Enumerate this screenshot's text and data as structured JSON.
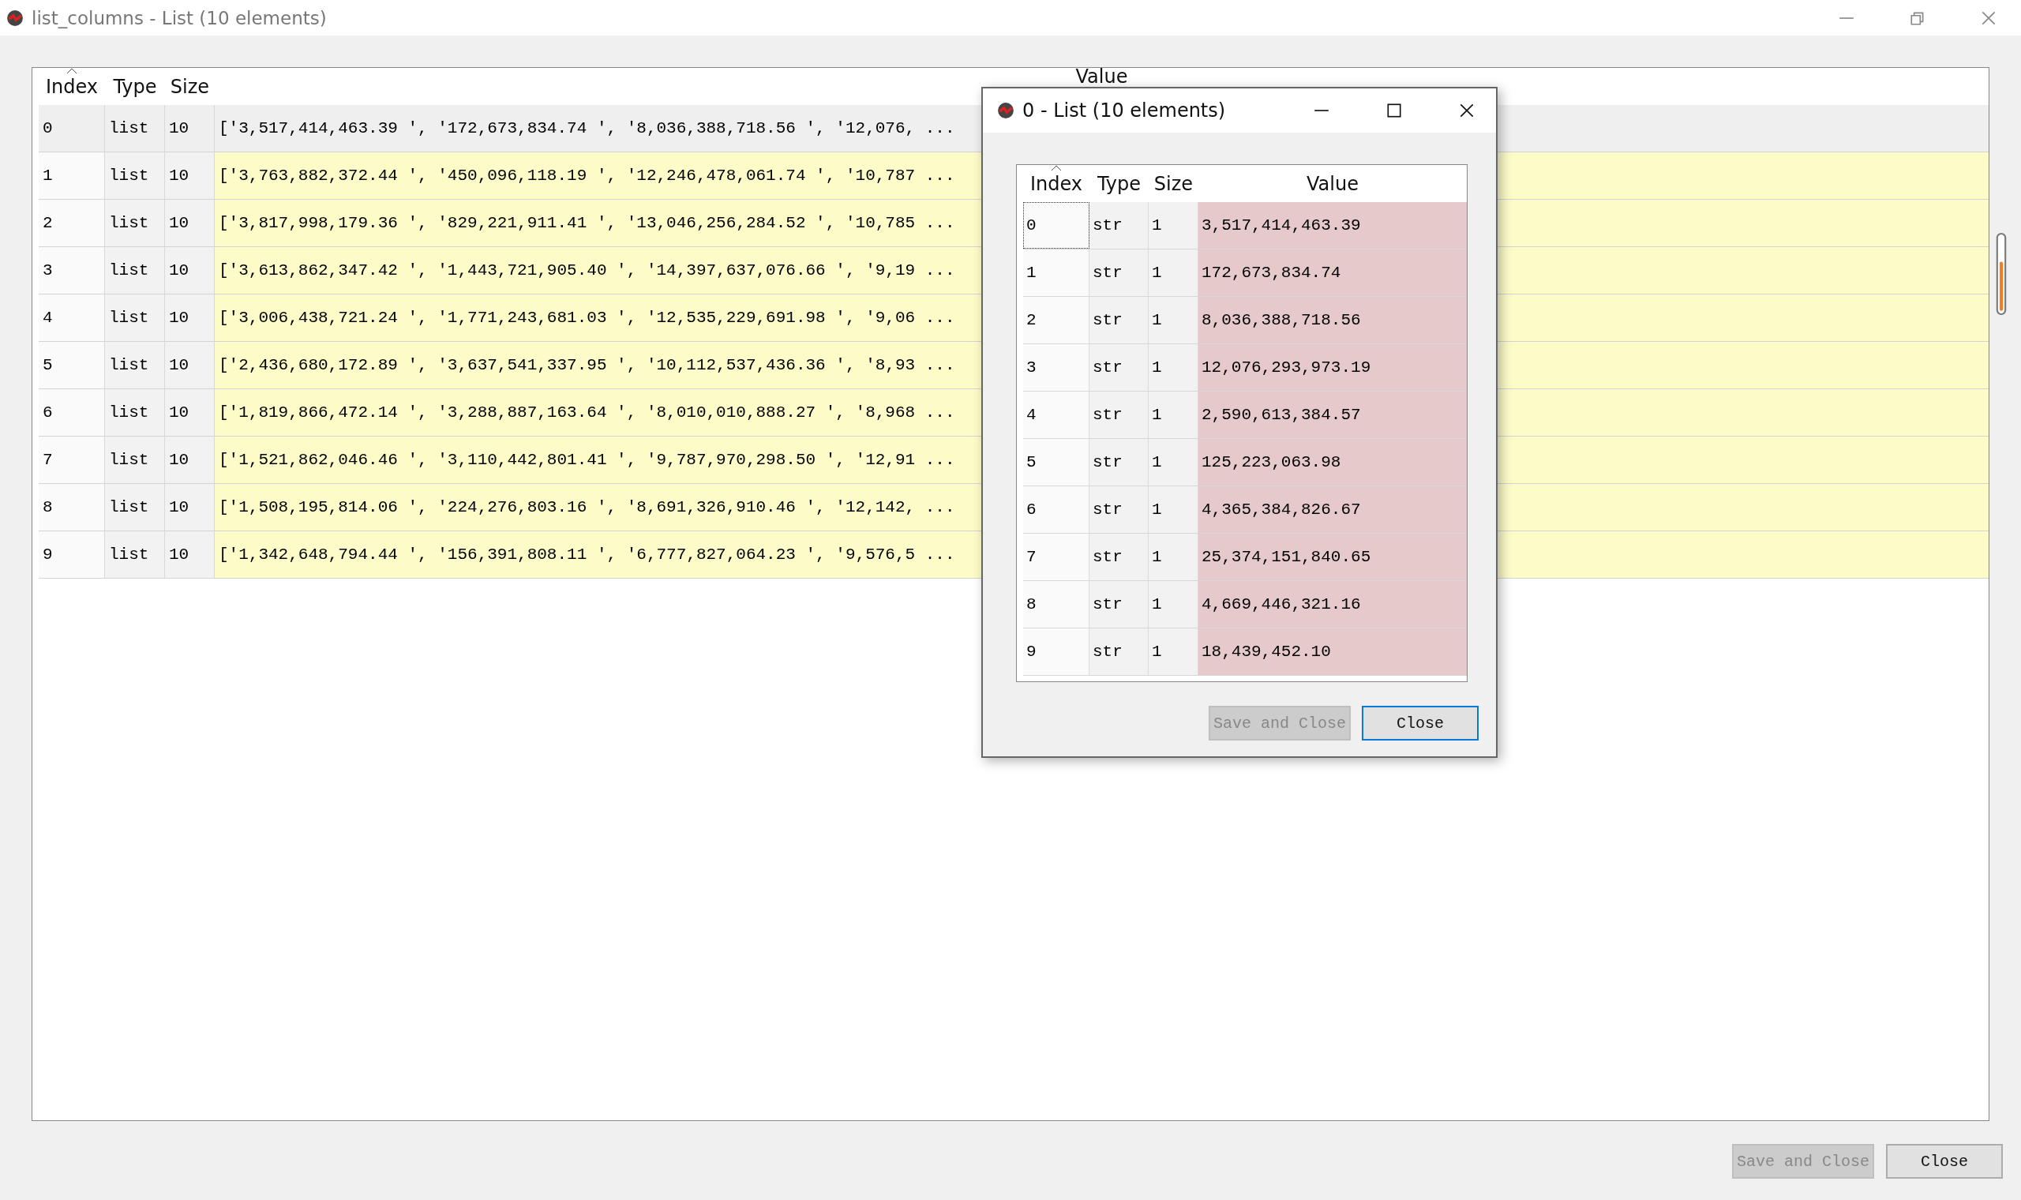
{
  "window": {
    "title": "list_columns - List (10 elements)"
  },
  "table": {
    "columns": [
      {
        "label": "Index",
        "sorted": true
      },
      {
        "label": "Type",
        "sorted": false
      },
      {
        "label": "Size",
        "sorted": false
      },
      {
        "label": "Value",
        "sorted": false
      }
    ],
    "rows": [
      {
        "index": "0",
        "type": "list",
        "size": "10",
        "value": "['3,517,414,463.39 ', '172,673,834.74 ', '8,036,388,718.56 ', '12,076, ...",
        "selected": true
      },
      {
        "index": "1",
        "type": "list",
        "size": "10",
        "value": "['3,763,882,372.44 ', '450,096,118.19 ', '12,246,478,061.74 ', '10,787 ...",
        "selected": false
      },
      {
        "index": "2",
        "type": "list",
        "size": "10",
        "value": "['3,817,998,179.36 ', '829,221,911.41 ', '13,046,256,284.52 ', '10,785 ...",
        "selected": false
      },
      {
        "index": "3",
        "type": "list",
        "size": "10",
        "value": "['3,613,862,347.42 ', '1,443,721,905.40 ', '14,397,637,076.66 ', '9,19 ...",
        "selected": false
      },
      {
        "index": "4",
        "type": "list",
        "size": "10",
        "value": "['3,006,438,721.24 ', '1,771,243,681.03 ', '12,535,229,691.98 ', '9,06 ...",
        "selected": false
      },
      {
        "index": "5",
        "type": "list",
        "size": "10",
        "value": "['2,436,680,172.89 ', '3,637,541,337.95 ', '10,112,537,436.36 ', '8,93 ...",
        "selected": false
      },
      {
        "index": "6",
        "type": "list",
        "size": "10",
        "value": "['1,819,866,472.14 ', '3,288,887,163.64 ', '8,010,010,888.27 ', '8,968 ...",
        "selected": false
      },
      {
        "index": "7",
        "type": "list",
        "size": "10",
        "value": "['1,521,862,046.46 ', '3,110,442,801.41 ', '9,787,970,298.50 ', '12,91 ...",
        "selected": false
      },
      {
        "index": "8",
        "type": "list",
        "size": "10",
        "value": "['1,508,195,814.06 ', '224,276,803.16 ', '8,691,326,910.46 ', '12,142, ...",
        "selected": false
      },
      {
        "index": "9",
        "type": "list",
        "size": "10",
        "value": "['1,342,648,794.44 ', '156,391,808.11 ', '6,777,827,064.23 ', '9,576,5 ...",
        "selected": false
      }
    ]
  },
  "buttons": [
    {
      "label": "Save and Close",
      "disabled": true,
      "default": false
    },
    {
      "label": "Close",
      "disabled": false,
      "default": false
    }
  ],
  "dialog": {
    "title": "0 - List (10 elements)",
    "table": {
      "columns": [
        {
          "label": "Index",
          "sorted": true
        },
        {
          "label": "Type",
          "sorted": false
        },
        {
          "label": "Size",
          "sorted": false
        },
        {
          "label": "Value",
          "sorted": false
        }
      ],
      "rows": [
        {
          "index": "0",
          "type": "str",
          "size": "1",
          "value": "3,517,414,463.39",
          "selected": true
        },
        {
          "index": "1",
          "type": "str",
          "size": "1",
          "value": "172,673,834.74",
          "selected": false
        },
        {
          "index": "2",
          "type": "str",
          "size": "1",
          "value": "8,036,388,718.56",
          "selected": false
        },
        {
          "index": "3",
          "type": "str",
          "size": "1",
          "value": "12,076,293,973.19",
          "selected": false
        },
        {
          "index": "4",
          "type": "str",
          "size": "1",
          "value": "2,590,613,384.57",
          "selected": false
        },
        {
          "index": "5",
          "type": "str",
          "size": "1",
          "value": "125,223,063.98",
          "selected": false
        },
        {
          "index": "6",
          "type": "str",
          "size": "1",
          "value": "4,365,384,826.67",
          "selected": false
        },
        {
          "index": "7",
          "type": "str",
          "size": "1",
          "value": "25,374,151,840.65",
          "selected": false
        },
        {
          "index": "8",
          "type": "str",
          "size": "1",
          "value": "4,669,446,321.16",
          "selected": false
        },
        {
          "index": "9",
          "type": "str",
          "size": "1",
          "value": "18,439,452.10",
          "selected": false
        }
      ]
    },
    "buttons": [
      {
        "label": "Save and Close",
        "disabled": true,
        "default": false
      },
      {
        "label": "Close",
        "disabled": false,
        "default": true
      }
    ]
  }
}
